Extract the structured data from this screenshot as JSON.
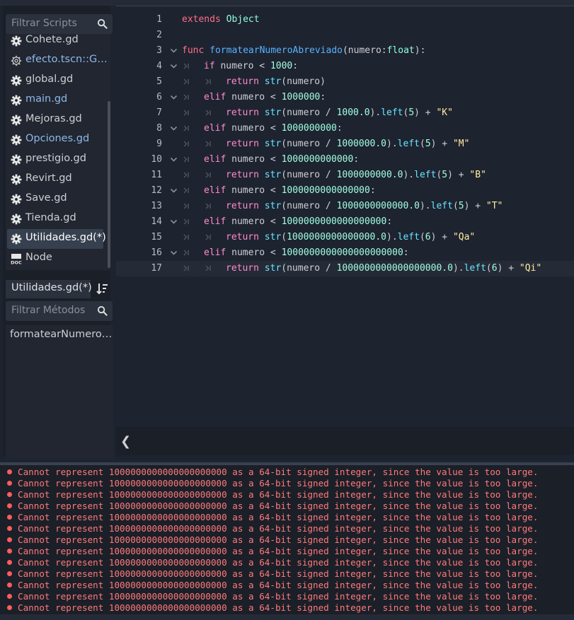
{
  "scripts_panel": {
    "filter_placeholder": "Filtrar Scripts",
    "items": [
      {
        "label": "Cohete.gd",
        "icon": "gear-icon",
        "style": "normal"
      },
      {
        "label": "efecto.tscn::G…",
        "icon": "gear-outline-icon",
        "style": "blue"
      },
      {
        "label": "global.gd",
        "icon": "gear-icon",
        "style": "normal"
      },
      {
        "label": "main.gd",
        "icon": "gear-icon",
        "style": "blue"
      },
      {
        "label": "Mejoras.gd",
        "icon": "gear-icon",
        "style": "normal"
      },
      {
        "label": "Opciones.gd",
        "icon": "gear-icon",
        "style": "blue"
      },
      {
        "label": "prestigio.gd",
        "icon": "gear-icon",
        "style": "normal"
      },
      {
        "label": "Revirt.gd",
        "icon": "gear-icon",
        "style": "normal"
      },
      {
        "label": "Save.gd",
        "icon": "gear-icon",
        "style": "normal"
      },
      {
        "label": "Tienda.gd",
        "icon": "gear-icon",
        "style": "normal"
      },
      {
        "label": "Utilidades.gd(*)",
        "icon": "gear-icon",
        "style": "selected"
      },
      {
        "label": "Node",
        "icon": "doc-icon",
        "style": "normal"
      }
    ]
  },
  "methods_panel": {
    "current_script": "Utilidades.gd(*)",
    "filter_placeholder": "Filtrar Métodos",
    "items": [
      "formatearNumero…"
    ]
  },
  "editor": {
    "current_line": 17,
    "lines": [
      {
        "n": "1"
      },
      {
        "n": "2"
      },
      {
        "n": "3"
      },
      {
        "n": "4"
      },
      {
        "n": "5"
      },
      {
        "n": "6"
      },
      {
        "n": "7"
      },
      {
        "n": "8"
      },
      {
        "n": "9"
      },
      {
        "n": "10"
      },
      {
        "n": "11"
      },
      {
        "n": "12"
      },
      {
        "n": "13"
      },
      {
        "n": "14"
      },
      {
        "n": "15"
      },
      {
        "n": "16"
      },
      {
        "n": "17"
      }
    ],
    "tokens": {
      "l1": [
        "extends",
        "Object"
      ],
      "l3": [
        "func",
        "formatearNumeroAbreviado",
        "(numero:",
        "float",
        "):"
      ],
      "l4": [
        "if",
        " numero < ",
        "1000",
        ":"
      ],
      "l5": [
        "return",
        "str",
        "(numero)"
      ],
      "l6": [
        "elif",
        " numero < ",
        "1000000",
        ":"
      ],
      "l7": [
        "return",
        "str",
        "(numero / ",
        "1000.0",
        ").",
        "left",
        "(",
        "5",
        ") + ",
        "\"K\""
      ],
      "l8": [
        "elif",
        " numero < ",
        "1000000000",
        ":"
      ],
      "l9": [
        "return",
        "str",
        "(numero / ",
        "1000000.0",
        ").",
        "left",
        "(",
        "5",
        ") + ",
        "\"M\""
      ],
      "l10": [
        "elif",
        " numero < ",
        "1000000000000",
        ":"
      ],
      "l11": [
        "return",
        "str",
        "(numero / ",
        "1000000000.0",
        ").",
        "left",
        "(",
        "5",
        ") + ",
        "\"B\""
      ],
      "l12": [
        "elif",
        " numero < ",
        "1000000000000000",
        ":"
      ],
      "l13": [
        "return",
        "str",
        "(numero / ",
        "1000000000000.0",
        ").",
        "left",
        "(",
        "5",
        ") + ",
        "\"T\""
      ],
      "l14": [
        "elif",
        " numero < ",
        "1000000000000000000",
        ":"
      ],
      "l15": [
        "return",
        "str",
        "(",
        "1000000000000000.0",
        ").",
        "left",
        "(",
        "6",
        ") + ",
        "\"Qa\""
      ],
      "l16": [
        "elif",
        " numero < ",
        "1000000000000000000000",
        ":"
      ],
      "l17": [
        "return",
        "str",
        "(numero / ",
        "1000000000000000000.0",
        ").",
        "left",
        "(",
        "6",
        ") + ",
        "\"Qi\""
      ]
    }
  },
  "output": {
    "error_text": "Cannot represent 1000000000000000000000 as a 64-bit signed integer, since the value is too large.",
    "error_count": 13,
    "error_color": "#ff7a7a"
  }
}
